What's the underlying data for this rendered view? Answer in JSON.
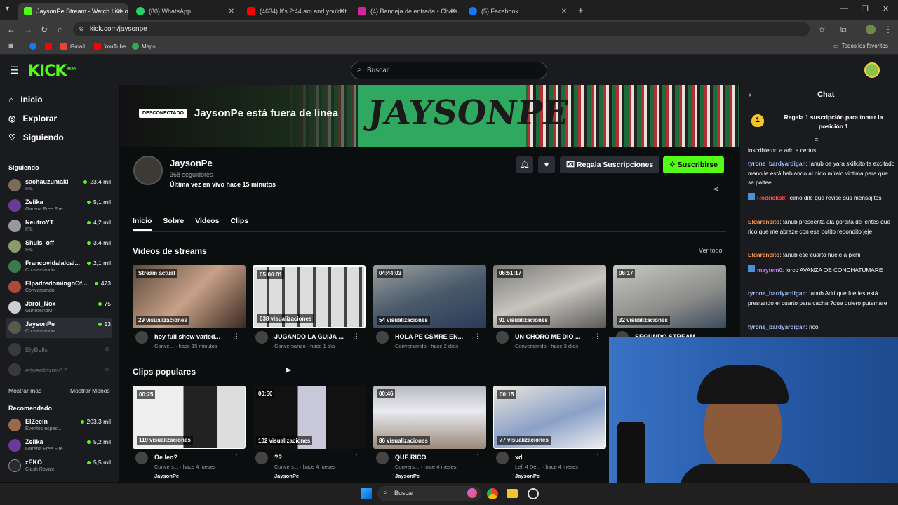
{
  "browser": {
    "tabs": [
      {
        "label": "JaysonPe Stream - Watch Live o",
        "color": "#53fc18"
      },
      {
        "label": "(80) WhatsApp",
        "color": "#25d366"
      },
      {
        "label": "(4634) It's 2:44 am and you're t",
        "color": "#ff0000"
      },
      {
        "label": "(4) Bandeja de entrada • Chats",
        "color": "#d6249f"
      },
      {
        "label": "(5) Facebook",
        "color": "#1877f2"
      }
    ],
    "url": "kick.com/jaysonpe",
    "bookmarks": [
      "Gmail",
      "YouTube",
      "Maps"
    ],
    "bookmarks_right": "Todos los favoritos"
  },
  "kick": {
    "logo": "KICK",
    "logo_sup": "BETA",
    "search_placeholder": "Buscar"
  },
  "sidebar": {
    "nav": [
      {
        "label": "Inicio",
        "icon": "⌂"
      },
      {
        "label": "Explorar",
        "icon": "◎"
      },
      {
        "label": "Siguiendo",
        "icon": "♡"
      }
    ],
    "following_title": "Siguiendo",
    "following": [
      {
        "name": "sachauzumaki",
        "cat": "IRL",
        "viewers": "23,4 mil"
      },
      {
        "name": "Zelika",
        "cat": "Garena Free Fire",
        "viewers": "5,1 mil"
      },
      {
        "name": "NeutroYT",
        "cat": "IRL",
        "viewers": "4,2 mil"
      },
      {
        "name": "Shuls_off",
        "cat": "IRL",
        "viewers": "3,4 mil"
      },
      {
        "name": "Francovidalalcal...",
        "cat": "Conversando",
        "viewers": "2,1 mil"
      },
      {
        "name": "ElpadredomingoOf...",
        "cat": "Conversando",
        "viewers": "473"
      },
      {
        "name": "Jarol_Nox",
        "cat": "GunboundM",
        "viewers": "75"
      },
      {
        "name": "JaysonPe",
        "cat": "Conversando",
        "viewers": "13"
      }
    ],
    "offline": [
      "ElyBells",
      "eduardoxmv17"
    ],
    "show_more": "Mostrar más",
    "show_less": "Mostrar Menos",
    "recommended_title": "Recomendado",
    "recommended": [
      {
        "name": "ElZeein",
        "cat": "Eventos especi...",
        "viewers": "203,3 mil"
      },
      {
        "name": "Zelika",
        "cat": "Garena Free Fire",
        "viewers": "5,2 mil"
      },
      {
        "name": "zEKO",
        "cat": "Clash Royale",
        "viewers": "5,5 mil"
      }
    ]
  },
  "channel": {
    "offline_badge": "DESCONECTADO",
    "offline_text": "JaysonPe está fuera de línea",
    "banner_text": "JAYSONPE",
    "name": "JaysonPe",
    "followers": "368 seguidores",
    "last_live": "Última vez en vivo hace 15 minutos",
    "gift_label": "Regala Suscripciones",
    "subscribe_label": "Suscribirse",
    "tabs": [
      "Inicio",
      "Sobre",
      "Videos",
      "Clips"
    ]
  },
  "streams": {
    "title": "Videos de streams",
    "see_all": "Ver todo",
    "items": [
      {
        "top": "Stream actual",
        "views": "29 visualizaciones",
        "title": "hoy full show varied...",
        "meta": "Conve... · hace 15 minutos"
      },
      {
        "top": "05:06:01",
        "views": "638 visualizaciones",
        "title": "JUGANDO LA GUIJA ...",
        "meta": "Conversando · hace 1 día"
      },
      {
        "top": "04:44:03",
        "views": "54 visualizaciones",
        "title": "HOLA PE CSMRE EN...",
        "meta": "Conversando · hace 2 días"
      },
      {
        "top": "06:51:17",
        "views": "91 visualizaciones",
        "title": "UN CHORO ME DIO ...",
        "meta": "Conversando · hace 3 días"
      },
      {
        "top": "06:17",
        "views": "32 visualizaciones",
        "title": "SEGUNDO STREAM ...",
        "meta": ""
      }
    ]
  },
  "clips": {
    "title": "Clips populares",
    "items": [
      {
        "top": "00:25",
        "views": "119 visualizaciones",
        "title": "Oe leo?",
        "meta": "Convers... · hace 4 meses",
        "user": "JaysonPe"
      },
      {
        "top": "00:50",
        "views": "102 visualizaciones",
        "title": "??",
        "meta": "Convers... · hace 4 meses",
        "user": "JaysonPe"
      },
      {
        "top": "00:46",
        "views": "86 visualizaciones",
        "title": "QUE RICO",
        "meta": "Convers... · hace 4 meses",
        "user": "JaysonPe"
      },
      {
        "top": "00:15",
        "views": "77 visualizaciones",
        "title": "xd",
        "meta": "Left 4 De... · hace 4 meses",
        "user": "JaysonPe"
      }
    ]
  },
  "chat": {
    "title": "Chat",
    "pinned": "Regala 1 suscripción para tomar la posición 1",
    "messages": [
      {
        "user": "",
        "text": "inscribieron a adri a certus",
        "color": "#ffffff"
      },
      {
        "user": "tyrone_bardyardigan",
        "text": ": !anub oe yara skillcito ta excitado mano le está hablando al oído míralo victima para que se paltee",
        "color": "#a0c4ff"
      },
      {
        "user": "Rodricks8",
        "text": ": leimo dile que revise sus mensajitos",
        "color": "#ff5050"
      },
      {
        "user": "Eldarencito",
        "text": ": !anub preseenta ala gordita de lentes que rico que me abraze con ese potito redondito jeje",
        "color": "#ff9a4a"
      },
      {
        "user": "Eldarencito",
        "text": ": !anub ese cuarto huele a pichi",
        "color": "#ff9a4a"
      },
      {
        "user": "maytem0",
        "text": ": !orco AVANZA OE CONCHATUMARE",
        "color": "#c77dff"
      },
      {
        "user": "tyrone_bardyardigan",
        "text": ": !anub Adri que fue les está prestando el cuarto para cachar?que quiero putamare",
        "color": "#a0c4ff"
      },
      {
        "user": "tyrone_bardyardigan",
        "text": ": rico",
        "color": "#a0c4ff"
      }
    ]
  },
  "taskbar": {
    "search": "Buscar"
  }
}
